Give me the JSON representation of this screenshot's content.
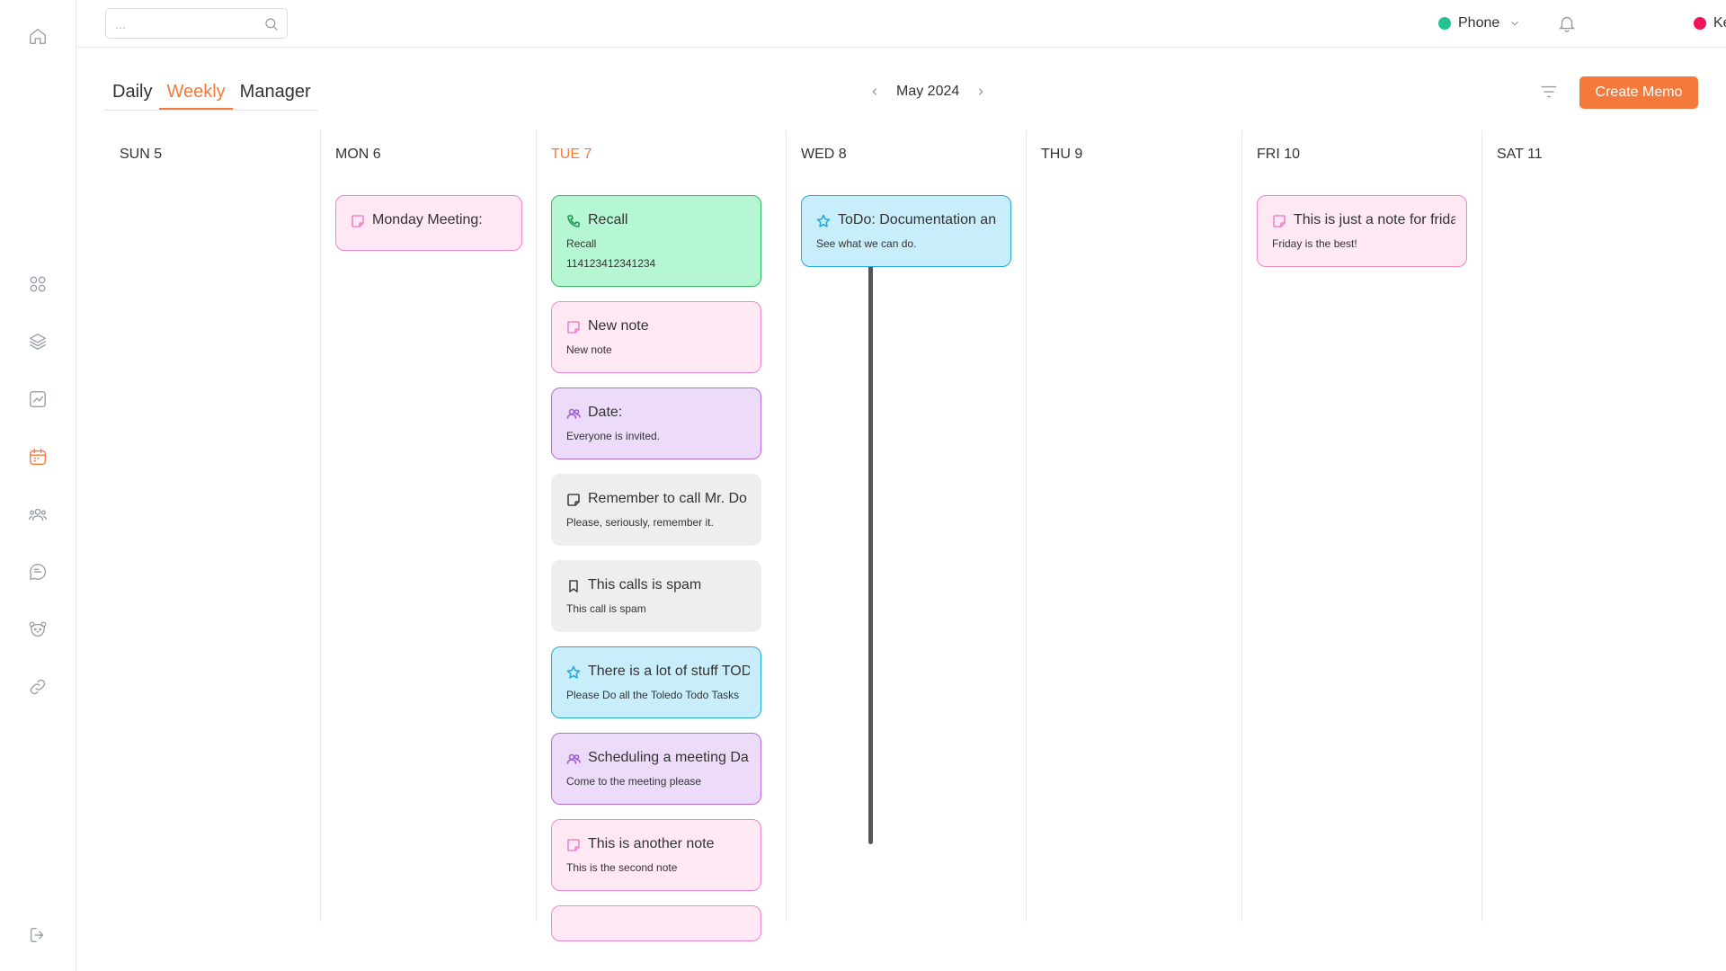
{
  "search": {
    "placeholder": "..."
  },
  "topbar": {
    "device": {
      "label": "Phone",
      "dot_color": "#22c38e"
    },
    "user": {
      "label": "Kevin",
      "dot_color": "#f0145a"
    }
  },
  "view_tabs": [
    {
      "label": "Daily",
      "active": false
    },
    {
      "label": "Weekly",
      "active": true
    },
    {
      "label": "Manager",
      "active": false
    }
  ],
  "month_label": "May 2024",
  "create_button": "Create Memo",
  "colors": {
    "accent": "#f5793b"
  },
  "days": [
    {
      "label": "SUN 5",
      "today": false
    },
    {
      "label": "MON 6",
      "today": false
    },
    {
      "label": "TUE 7",
      "today": true
    },
    {
      "label": "WED 8",
      "today": false
    },
    {
      "label": "THU 9",
      "today": false
    },
    {
      "label": "FRI 10",
      "today": false
    },
    {
      "label": "SAT 11",
      "today": false
    }
  ],
  "memos": {
    "mon": [
      {
        "title": "Monday Meeting:",
        "body": "",
        "type": "note",
        "color": "pink"
      }
    ],
    "tue": [
      {
        "title": "Recall",
        "body": "Recall",
        "body2": "114123412341234",
        "type": "phone",
        "color": "green"
      },
      {
        "title": "New note",
        "body": "New note",
        "type": "note",
        "color": "pink"
      },
      {
        "title": "Date:",
        "body": "Everyone is invited.",
        "type": "people",
        "color": "purple"
      },
      {
        "title": "Remember to call Mr. Do",
        "body": "Please, seriously, remember it.",
        "type": "note",
        "color": "gray"
      },
      {
        "title": "This calls is spam",
        "body": "This call is spam",
        "type": "bookmark",
        "color": "gray"
      },
      {
        "title": "There is a lot of stuff TOD",
        "body": "Please Do all the Toledo Todo Tasks",
        "type": "star",
        "color": "blue"
      },
      {
        "title": "Scheduling a meeting Da",
        "body": "Come to the meeting please",
        "type": "people",
        "color": "purple"
      },
      {
        "title": "This is another note",
        "body": "This is the second note",
        "type": "note",
        "color": "pink"
      }
    ],
    "wed": [
      {
        "title": "ToDo: Documentation an",
        "body": "See what we can do.",
        "type": "star",
        "color": "blue"
      }
    ],
    "fri": [
      {
        "title": "This is just a note for frida",
        "body": "Friday is the best!",
        "type": "note",
        "color": "pink"
      }
    ]
  },
  "sidebar_icons": [
    "home-icon",
    "grid-icon",
    "layers-icon",
    "chart-icon",
    "calendar-icon",
    "users-icon",
    "chat-icon",
    "bear-icon",
    "link-icon",
    "logout-icon"
  ]
}
